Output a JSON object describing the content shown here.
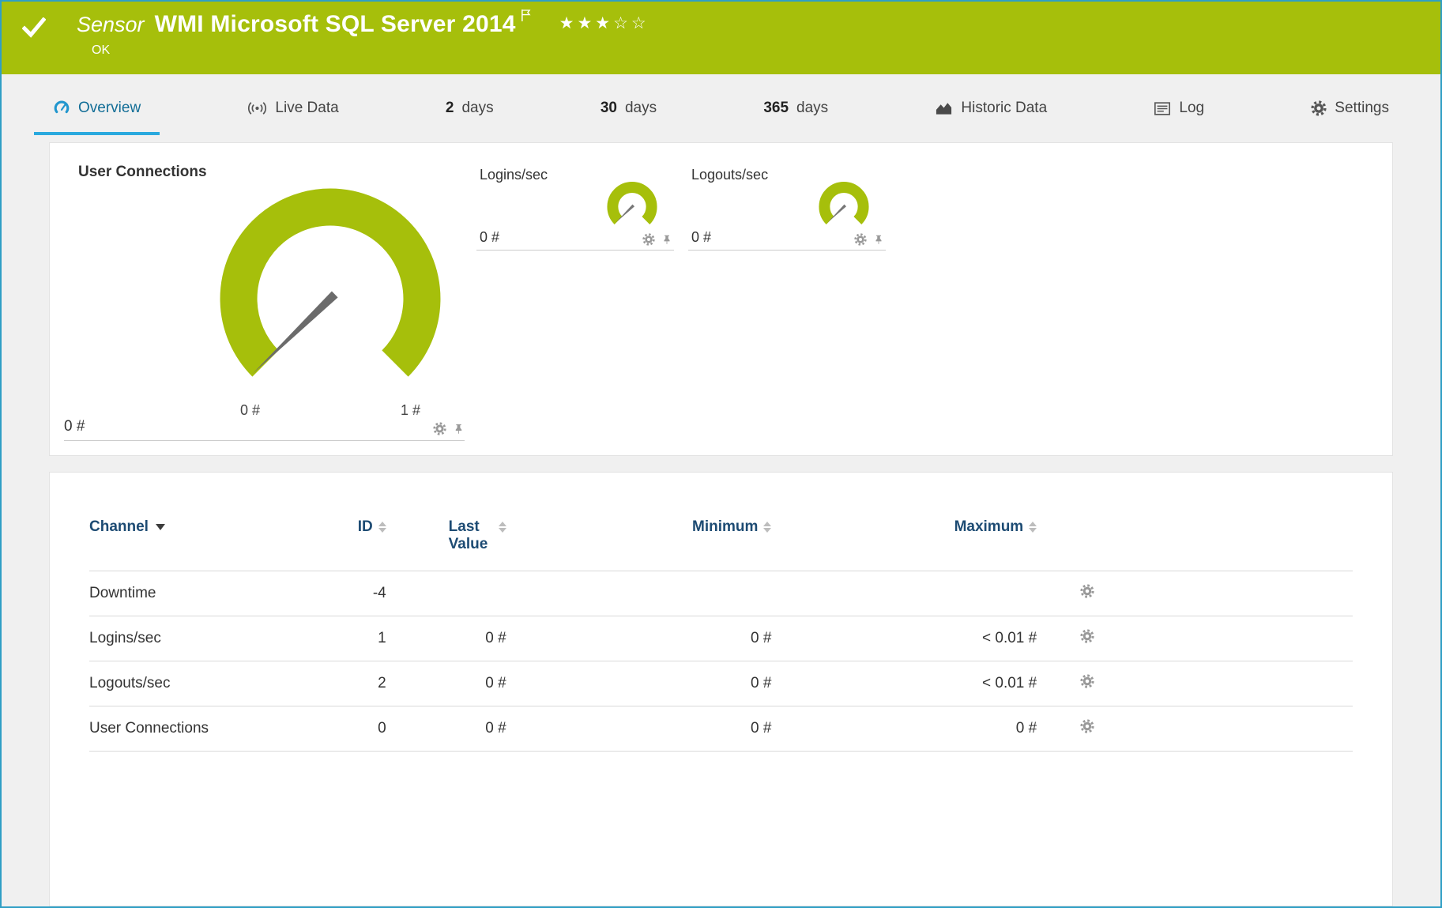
{
  "header": {
    "kind_label": "Sensor",
    "title": "WMI Microsoft SQL Server 2014",
    "status": "OK",
    "stars": "★★★☆☆",
    "icons": [
      "check-icon",
      "flag-icon",
      "star-rating"
    ]
  },
  "tabs": [
    {
      "label": "Overview",
      "icon": "gauge-icon",
      "active": true
    },
    {
      "label": "Live Data",
      "icon": "live-signal-icon",
      "active": false
    },
    {
      "number": "2",
      "label": "days",
      "active": false
    },
    {
      "number": "30",
      "label": "days",
      "active": false
    },
    {
      "number": "365",
      "label": "days",
      "active": false
    },
    {
      "label": "Historic Data",
      "icon": "area-chart-icon",
      "active": false
    },
    {
      "label": "Log",
      "icon": "log-list-icon",
      "active": false
    },
    {
      "label": "Settings",
      "icon": "gear-icon",
      "active": false
    }
  ],
  "gauges": {
    "main": {
      "title": "User Connections",
      "value": "0 #",
      "scale_min": "0 #",
      "scale_max": "1 #"
    },
    "small": [
      {
        "title": "Logins/sec",
        "value": "0 #"
      },
      {
        "title": "Logouts/sec",
        "value": "0 #"
      }
    ]
  },
  "channel_table": {
    "headers": {
      "channel": "Channel",
      "id": "ID",
      "last_value": "Last Value",
      "minimum": "Minimum",
      "maximum": "Maximum"
    },
    "rows": [
      {
        "channel": "Downtime",
        "id": "-4",
        "last_value": "",
        "minimum": "",
        "maximum": ""
      },
      {
        "channel": "Logins/sec",
        "id": "1",
        "last_value": "0 #",
        "minimum": "0 #",
        "maximum": "< 0.01 #"
      },
      {
        "channel": "Logouts/sec",
        "id": "2",
        "last_value": "0 #",
        "minimum": "0 #",
        "maximum": "< 0.01 #"
      },
      {
        "channel": "User Connections",
        "id": "0",
        "last_value": "0 #",
        "minimum": "0 #",
        "maximum": "0 #"
      }
    ]
  },
  "colors": {
    "header_bg": "#a6bf0b",
    "gauge": "#a6bf0b",
    "tab_active_underline": "#2aa9de",
    "tab_active_text": "#116d96",
    "table_header_text": "#1d4b73"
  }
}
